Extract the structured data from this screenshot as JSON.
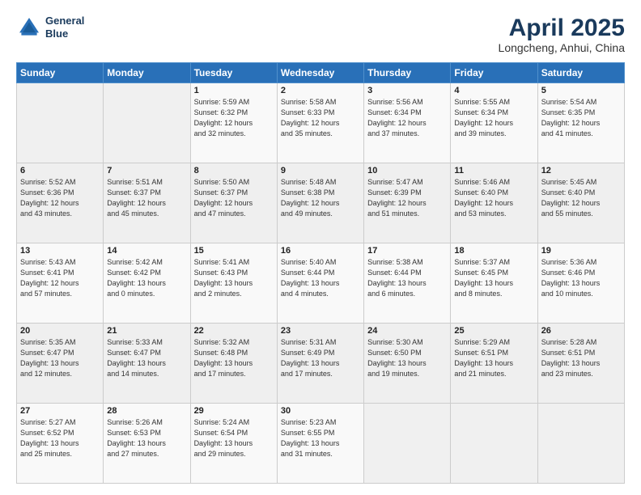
{
  "header": {
    "logo_line1": "General",
    "logo_line2": "Blue",
    "title": "April 2025",
    "subtitle": "Longcheng, Anhui, China"
  },
  "weekdays": [
    "Sunday",
    "Monday",
    "Tuesday",
    "Wednesday",
    "Thursday",
    "Friday",
    "Saturday"
  ],
  "weeks": [
    [
      {
        "day": "",
        "info": ""
      },
      {
        "day": "",
        "info": ""
      },
      {
        "day": "1",
        "info": "Sunrise: 5:59 AM\nSunset: 6:32 PM\nDaylight: 12 hours\nand 32 minutes."
      },
      {
        "day": "2",
        "info": "Sunrise: 5:58 AM\nSunset: 6:33 PM\nDaylight: 12 hours\nand 35 minutes."
      },
      {
        "day": "3",
        "info": "Sunrise: 5:56 AM\nSunset: 6:34 PM\nDaylight: 12 hours\nand 37 minutes."
      },
      {
        "day": "4",
        "info": "Sunrise: 5:55 AM\nSunset: 6:34 PM\nDaylight: 12 hours\nand 39 minutes."
      },
      {
        "day": "5",
        "info": "Sunrise: 5:54 AM\nSunset: 6:35 PM\nDaylight: 12 hours\nand 41 minutes."
      }
    ],
    [
      {
        "day": "6",
        "info": "Sunrise: 5:52 AM\nSunset: 6:36 PM\nDaylight: 12 hours\nand 43 minutes."
      },
      {
        "day": "7",
        "info": "Sunrise: 5:51 AM\nSunset: 6:37 PM\nDaylight: 12 hours\nand 45 minutes."
      },
      {
        "day": "8",
        "info": "Sunrise: 5:50 AM\nSunset: 6:37 PM\nDaylight: 12 hours\nand 47 minutes."
      },
      {
        "day": "9",
        "info": "Sunrise: 5:48 AM\nSunset: 6:38 PM\nDaylight: 12 hours\nand 49 minutes."
      },
      {
        "day": "10",
        "info": "Sunrise: 5:47 AM\nSunset: 6:39 PM\nDaylight: 12 hours\nand 51 minutes."
      },
      {
        "day": "11",
        "info": "Sunrise: 5:46 AM\nSunset: 6:40 PM\nDaylight: 12 hours\nand 53 minutes."
      },
      {
        "day": "12",
        "info": "Sunrise: 5:45 AM\nSunset: 6:40 PM\nDaylight: 12 hours\nand 55 minutes."
      }
    ],
    [
      {
        "day": "13",
        "info": "Sunrise: 5:43 AM\nSunset: 6:41 PM\nDaylight: 12 hours\nand 57 minutes."
      },
      {
        "day": "14",
        "info": "Sunrise: 5:42 AM\nSunset: 6:42 PM\nDaylight: 13 hours\nand 0 minutes."
      },
      {
        "day": "15",
        "info": "Sunrise: 5:41 AM\nSunset: 6:43 PM\nDaylight: 13 hours\nand 2 minutes."
      },
      {
        "day": "16",
        "info": "Sunrise: 5:40 AM\nSunset: 6:44 PM\nDaylight: 13 hours\nand 4 minutes."
      },
      {
        "day": "17",
        "info": "Sunrise: 5:38 AM\nSunset: 6:44 PM\nDaylight: 13 hours\nand 6 minutes."
      },
      {
        "day": "18",
        "info": "Sunrise: 5:37 AM\nSunset: 6:45 PM\nDaylight: 13 hours\nand 8 minutes."
      },
      {
        "day": "19",
        "info": "Sunrise: 5:36 AM\nSunset: 6:46 PM\nDaylight: 13 hours\nand 10 minutes."
      }
    ],
    [
      {
        "day": "20",
        "info": "Sunrise: 5:35 AM\nSunset: 6:47 PM\nDaylight: 13 hours\nand 12 minutes."
      },
      {
        "day": "21",
        "info": "Sunrise: 5:33 AM\nSunset: 6:47 PM\nDaylight: 13 hours\nand 14 minutes."
      },
      {
        "day": "22",
        "info": "Sunrise: 5:32 AM\nSunset: 6:48 PM\nDaylight: 13 hours\nand 17 minutes."
      },
      {
        "day": "23",
        "info": "Sunrise: 5:31 AM\nSunset: 6:49 PM\nDaylight: 13 hours\nand 17 minutes."
      },
      {
        "day": "24",
        "info": "Sunrise: 5:30 AM\nSunset: 6:50 PM\nDaylight: 13 hours\nand 19 minutes."
      },
      {
        "day": "25",
        "info": "Sunrise: 5:29 AM\nSunset: 6:51 PM\nDaylight: 13 hours\nand 21 minutes."
      },
      {
        "day": "26",
        "info": "Sunrise: 5:28 AM\nSunset: 6:51 PM\nDaylight: 13 hours\nand 23 minutes."
      }
    ],
    [
      {
        "day": "27",
        "info": "Sunrise: 5:27 AM\nSunset: 6:52 PM\nDaylight: 13 hours\nand 25 minutes."
      },
      {
        "day": "28",
        "info": "Sunrise: 5:26 AM\nSunset: 6:53 PM\nDaylight: 13 hours\nand 27 minutes."
      },
      {
        "day": "29",
        "info": "Sunrise: 5:24 AM\nSunset: 6:54 PM\nDaylight: 13 hours\nand 29 minutes."
      },
      {
        "day": "30",
        "info": "Sunrise: 5:23 AM\nSunset: 6:55 PM\nDaylight: 13 hours\nand 31 minutes."
      },
      {
        "day": "",
        "info": ""
      },
      {
        "day": "",
        "info": ""
      },
      {
        "day": "",
        "info": ""
      }
    ]
  ]
}
